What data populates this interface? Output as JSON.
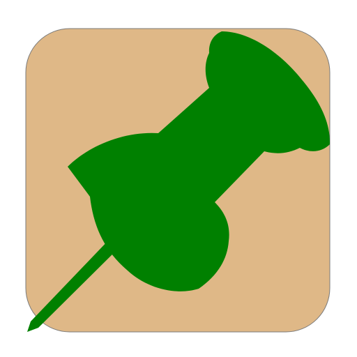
{
  "app_icon": {
    "name": "pushpin-icon",
    "background_color": "#DFB887",
    "border_color": "#7A7A7A",
    "pin_color": "#008000"
  }
}
